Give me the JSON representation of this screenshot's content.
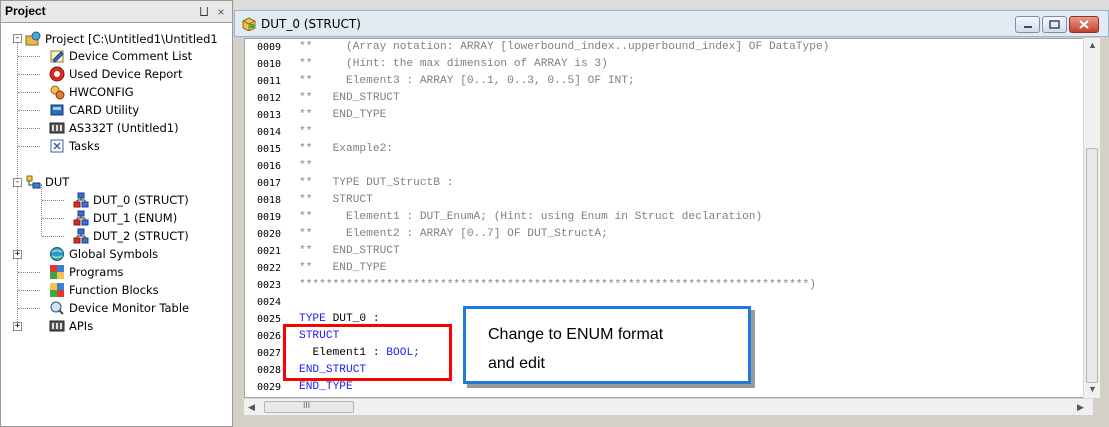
{
  "project_panel": {
    "title": "Project",
    "pin": "⨆",
    "close": "×",
    "tree": [
      {
        "label": "Project [C:\\Untitled1\\Untitled1",
        "icon": "project-icon",
        "toggle": "-"
      },
      {
        "label": "Device Comment List",
        "icon": "pencil-note-icon"
      },
      {
        "label": "Used Device Report",
        "icon": "red-report-icon"
      },
      {
        "label": "HWCONFIG",
        "icon": "hardware-config-icon"
      },
      {
        "label": "CARD Utility",
        "icon": "card-icon"
      },
      {
        "label": "AS332T  (Untitled1)",
        "icon": "device-icon"
      },
      {
        "label": "Tasks",
        "icon": "tasks-icon"
      },
      {
        "label": "DUT",
        "icon": "dut-folder-icon",
        "toggle": "-"
      },
      {
        "label": "DUT_0 (STRUCT)",
        "icon": "struct-icon",
        "selected": true
      },
      {
        "label": "DUT_1 (ENUM)",
        "icon": "struct-icon"
      },
      {
        "label": "DUT_2 (STRUCT)",
        "icon": "struct-icon"
      },
      {
        "label": "Global Symbols",
        "icon": "globe-icon",
        "toggle": "+"
      },
      {
        "label": "Programs",
        "icon": "programs-icon"
      },
      {
        "label": "Function Blocks",
        "icon": "function-blocks-icon"
      },
      {
        "label": "Device Monitor Table",
        "icon": "monitor-icon"
      },
      {
        "label": "APIs",
        "icon": "apis-icon",
        "toggle": "+"
      }
    ]
  },
  "editor": {
    "tab_title": "DUT_0 (STRUCT)",
    "lines": [
      {
        "num": "0009",
        "text": "**     (Array notation: ARRAY [lowerbound_index..upperbound_index] OF DataType)"
      },
      {
        "num": "0010",
        "text": "**     (Hint: the max dimension of ARRAY is 3)"
      },
      {
        "num": "0011",
        "text": "**     Element3 : ARRAY [0..1, 0..3, 0..5] OF INT;"
      },
      {
        "num": "0012",
        "text": "**   END_STRUCT"
      },
      {
        "num": "0013",
        "text": "**   END_TYPE"
      },
      {
        "num": "0014",
        "text": "**"
      },
      {
        "num": "0015",
        "text": "**   Example2:"
      },
      {
        "num": "0016",
        "text": "**"
      },
      {
        "num": "0017",
        "text": "**   TYPE DUT_StructB :"
      },
      {
        "num": "0018",
        "text": "**   STRUCT"
      },
      {
        "num": "0019",
        "text": "**     Element1 : DUT_EnumA; (Hint: using Enum in Struct declaration)"
      },
      {
        "num": "0020",
        "text": "**     Element2 : ARRAY [0..7] OF DUT_StructA;"
      },
      {
        "num": "0021",
        "text": "**   END_STRUCT"
      },
      {
        "num": "0022",
        "text": "**   END_TYPE"
      },
      {
        "num": "0023",
        "text": "****************************************************************************)"
      },
      {
        "num": "0024",
        "text": ""
      },
      {
        "num": "0025",
        "text": "TYPE DUT_0 :"
      },
      {
        "num": "0026",
        "text": "STRUCT"
      },
      {
        "num": "0027",
        "text": "  Element1 : BOOL;"
      },
      {
        "num": "0028",
        "text": "END_STRUCT"
      },
      {
        "num": "0029",
        "text": "END_TYPE"
      }
    ],
    "code_tail": {
      "type_kw": "TYPE",
      "dut_name": "DUT_0 :",
      "struct_kw": "STRUCT",
      "element": "Element1 : ",
      "bool": "BOOL;",
      "end_struct": "END_STRUCT",
      "end_type": "END_TYPE"
    },
    "hscroll_glyph": "III"
  },
  "callout": {
    "line1": "Change to ENUM format",
    "line2": "and edit",
    "border_color": "#1f7ad8"
  },
  "highlight_color": "#ff0000"
}
